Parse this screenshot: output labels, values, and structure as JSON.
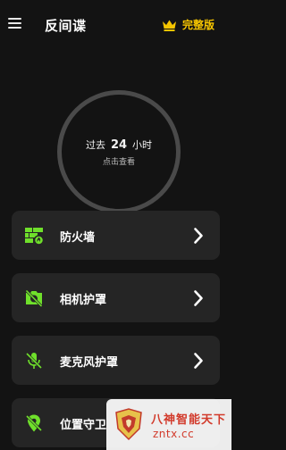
{
  "header": {
    "title": "反间谍",
    "premium_label": "完整版",
    "accent_color": "#f6c500",
    "icons": [
      "menu-icon",
      "crown-icon"
    ]
  },
  "summary": {
    "prefix": "过去",
    "hours": "24",
    "suffix": "小时",
    "hint": "点击查看"
  },
  "cards": [
    {
      "label": "防火墙",
      "icon": "firewall-icon"
    },
    {
      "label": "相机护罩",
      "icon": "camera-off-icon"
    },
    {
      "label": "麦克风护罩",
      "icon": "mic-off-icon"
    },
    {
      "label": "位置守卫",
      "icon": "location-off-icon"
    }
  ],
  "icon_color": "#6fe02b",
  "watermark": {
    "title": "八神智能天下",
    "url": "zntx.cc"
  }
}
